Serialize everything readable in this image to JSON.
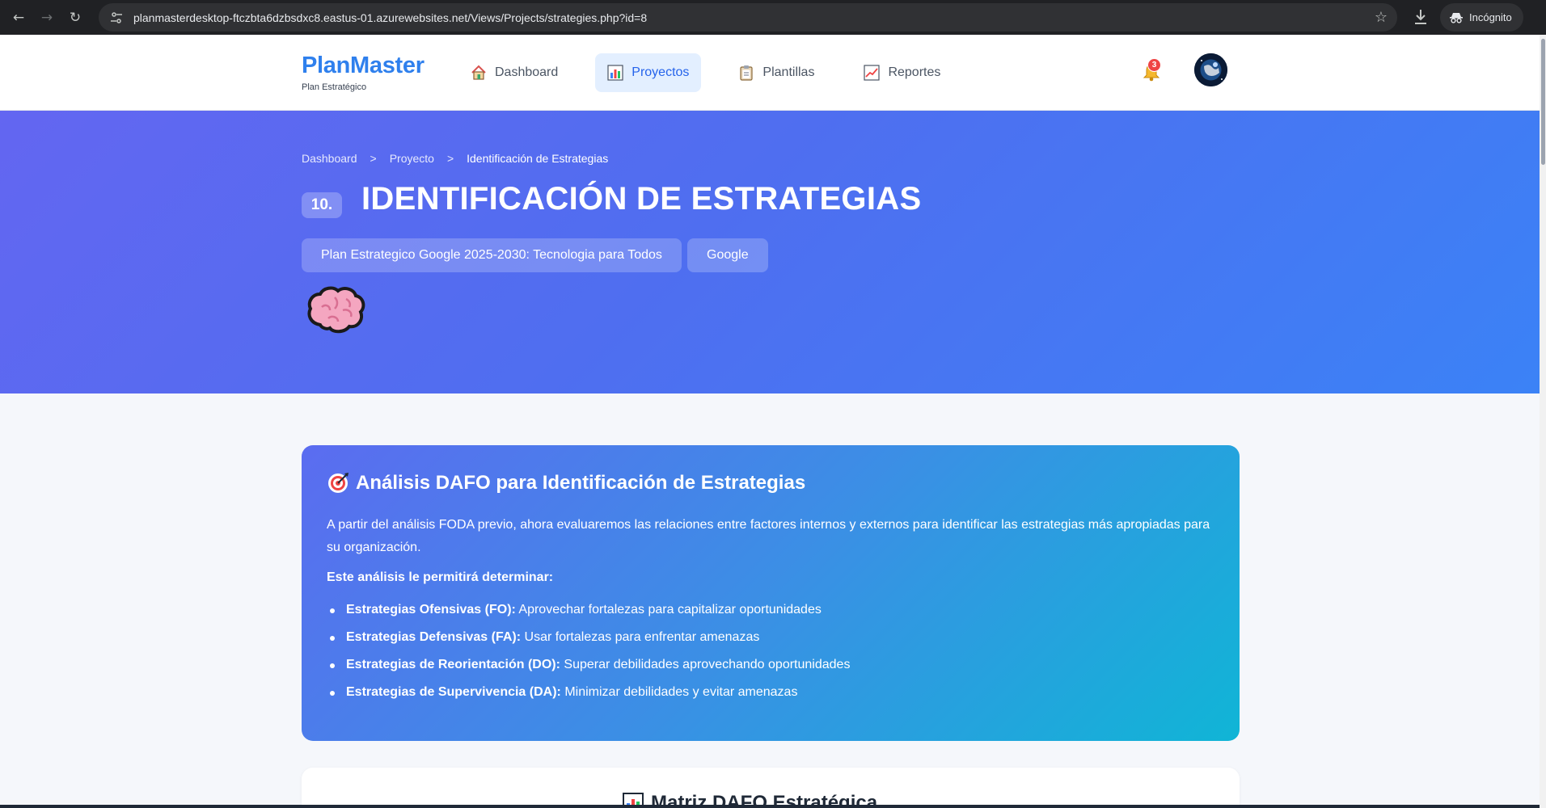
{
  "browser": {
    "url": "planmasterdesktop-ftczbta6dzbsdxc8.eastus-01.azurewebsites.net/Views/Projects/strategies.php?id=8",
    "profile_label": "Incógnito",
    "icons": [
      "back-arrow-icon",
      "forward-arrow-icon",
      "reload-icon",
      "site-settings-icon",
      "bookmark-star-icon",
      "download-icon",
      "incognito-icon"
    ]
  },
  "header": {
    "brand_name": "PlanMaster",
    "brand_subtitle": "Plan Estratégico",
    "nav": [
      {
        "label": "Dashboard",
        "icon": "house-icon",
        "active": false
      },
      {
        "label": "Proyectos",
        "icon": "bar-chart-icon",
        "active": true
      },
      {
        "label": "Plantillas",
        "icon": "clipboard-icon",
        "active": false
      },
      {
        "label": "Reportes",
        "icon": "line-chart-icon",
        "active": false
      }
    ],
    "notifications_count": "3",
    "accent_color": "#2f80ed"
  },
  "hero": {
    "breadcrumb": [
      "Dashboard",
      "Proyecto",
      "Identificación de Estrategias"
    ],
    "breadcrumb_separator": ">",
    "step_number": "10.",
    "title": "IDENTIFICACIÓN DE ESTRATEGIAS",
    "project_name": "Plan Estrategico Google 2025-2030: Tecnologia para Todos",
    "company": "Google",
    "illustration": "brain-icon"
  },
  "dafo": {
    "title": "Análisis DAFO para Identificación de Estrategias",
    "icon": "target-icon",
    "description": "A partir del análisis FODA previo, ahora evaluaremos las relaciones entre factores internos y externos para identificar las estrategias más apropiadas para su organización.",
    "lead": "Este análisis le permitirá determinar:",
    "items": [
      {
        "term": "Estrategias Ofensivas (FO):",
        "text": " Aprovechar fortalezas para capitalizar oportunidades"
      },
      {
        "term": "Estrategias Defensivas (FA):",
        "text": " Usar fortalezas para enfrentar amenazas"
      },
      {
        "term": "Estrategias de Reorientación (DO):",
        "text": " Superar debilidades aprovechando oportunidades"
      },
      {
        "term": "Estrategias de Supervivencia (DA):",
        "text": " Minimizar debilidades y evitar amenazas"
      }
    ]
  },
  "matrix": {
    "title": "Matriz DAFO Estratégica",
    "icon": "chart-icon"
  }
}
